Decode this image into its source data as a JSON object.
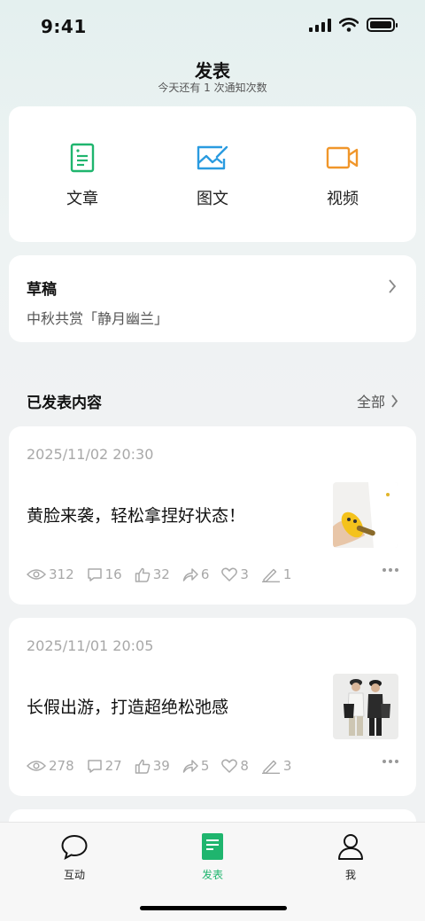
{
  "status_bar": {
    "time": "9:41"
  },
  "header": {
    "title": "发表",
    "subtitle": "今天还有 1 次通知次数"
  },
  "publish": {
    "buttons": [
      {
        "label": "文章",
        "icon": "document-icon",
        "color": "#1fb56e"
      },
      {
        "label": "图文",
        "icon": "image-edit-icon",
        "color": "#2a9be0"
      },
      {
        "label": "视频",
        "icon": "video-camera-icon",
        "color": "#f0962a"
      }
    ]
  },
  "draft": {
    "title": "草稿",
    "subtitle": "中秋共赏「静月幽兰」"
  },
  "published": {
    "title": "已发表内容",
    "all_label": "全部"
  },
  "posts": [
    {
      "date": "2025/11/02 20:30",
      "title": "黄脸来袭，轻松拿捏好状态！",
      "thumb": "yellow-toy-photo",
      "stats": {
        "views": "312",
        "comments": "16",
        "likes": "32",
        "shares": "6",
        "favorites": "3",
        "edits": "1"
      }
    },
    {
      "date": "2025/11/01 20:05",
      "title": "长假出游，打造超绝松弛感",
      "thumb": "couple-outfit-photo",
      "stats": {
        "views": "278",
        "comments": "27",
        "likes": "39",
        "shares": "5",
        "favorites": "8",
        "edits": "3"
      }
    }
  ],
  "tabs": [
    {
      "label": "互动",
      "icon": "chat-bubble-icon"
    },
    {
      "label": "发表",
      "icon": "publish-document-icon",
      "active": true
    },
    {
      "label": "我",
      "icon": "person-icon"
    }
  ],
  "colors": {
    "accent": "#1fb56e",
    "muted": "#a8a8a8"
  }
}
